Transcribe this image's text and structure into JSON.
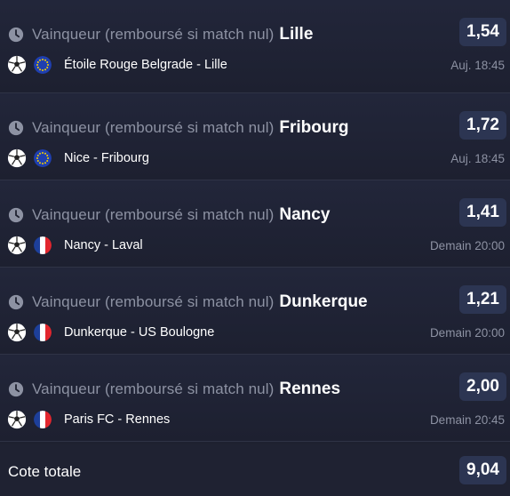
{
  "bets": [
    {
      "market": "Vainqueur (remboursé si match nul)",
      "pick": "Lille",
      "odds": "1,54",
      "event": "Étoile Rouge Belgrade - Lille",
      "time": "Auj. 18:45",
      "flag": "eu"
    },
    {
      "market": "Vainqueur (remboursé si match nul)",
      "pick": "Fribourg",
      "odds": "1,72",
      "event": "Nice - Fribourg",
      "time": "Auj. 18:45",
      "flag": "eu"
    },
    {
      "market": "Vainqueur (remboursé si match nul)",
      "pick": "Nancy",
      "odds": "1,41",
      "event": "Nancy - Laval",
      "time": "Demain 20:00",
      "flag": "fr"
    },
    {
      "market": "Vainqueur (remboursé si match nul)",
      "pick": "Dunkerque",
      "odds": "1,21",
      "event": "Dunkerque - US Boulogne",
      "time": "Demain 20:00",
      "flag": "fr"
    },
    {
      "market": "Vainqueur (remboursé si match nul)",
      "pick": "Rennes",
      "odds": "2,00",
      "event": "Paris FC - Rennes",
      "time": "Demain 20:45",
      "flag": "fr"
    }
  ],
  "total": {
    "label": "Cote totale",
    "odds": "9,04"
  },
  "colors": {
    "background": "#1e2130",
    "odds_badge": "#2c3552",
    "muted_text": "#8d92a3"
  }
}
